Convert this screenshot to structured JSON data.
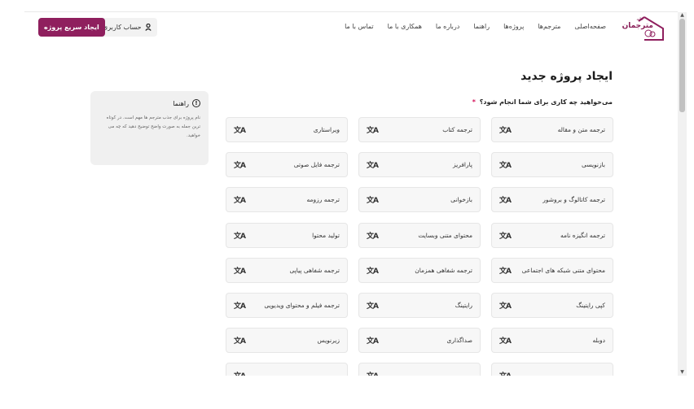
{
  "header": {
    "logo_small": "خانه",
    "logo_text": "مترجمان",
    "nav": [
      "صفحه‌اصلی",
      "مترجم‌ها",
      "پروژه‌ها",
      "راهنما",
      "درباره ما",
      "همکاری با ما",
      "تماس با ما"
    ],
    "account_label": "حساب کاربری",
    "cta_label": "ایجاد سریع پروژه"
  },
  "page": {
    "title": "ایجاد پروژه جدید",
    "question": "می‌خواهید چه کاری برای شما انجام شود؟",
    "required_mark": "*"
  },
  "help": {
    "title": "راهنما",
    "icon_text": "!",
    "text": "نام پروژه برای جذب مترجم ها مهم است. در کوتاه ترین جمله به صورت واضح توضیح دهید که چه می خواهید."
  },
  "card_icon_text": "文A",
  "services": [
    [
      "ترجمه متن و مقاله",
      "ترجمه کتاب",
      "ویراستاری"
    ],
    [
      "بازنویسی",
      "پارافریز",
      "ترجمه فایل صوتی"
    ],
    [
      "ترجمه کاتالوگ و بروشور",
      "بازخوانی",
      "ترجمه رزومه"
    ],
    [
      "ترجمه انگیزه نامه",
      "محتوای متنی وبسایت",
      "تولید محتوا"
    ],
    [
      "محتوای متنی شبکه های اجتماعی",
      "ترجمه شفاهی همزمان",
      "ترجمه شفاهی پیاپی"
    ],
    [
      "کپی رایتینگ",
      "رایتینگ",
      "ترجمه فیلم و محتوای ویدیویی"
    ],
    [
      "دوبله",
      "صداگذاری",
      "زیرنویس"
    ]
  ],
  "colors": {
    "brand": "#8f1f5e",
    "required": "#d4145a"
  }
}
